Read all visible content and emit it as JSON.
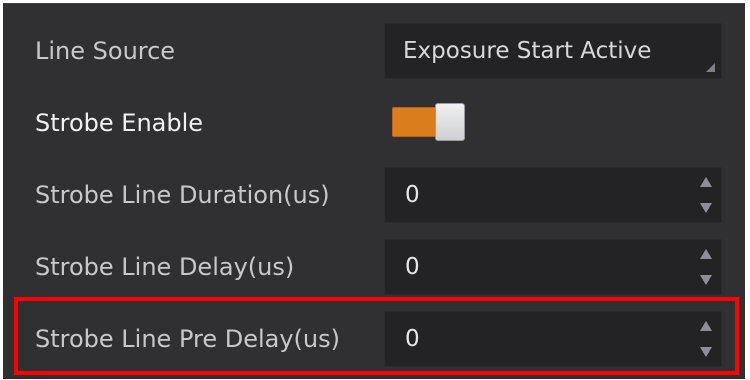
{
  "properties": [
    {
      "label": "Line Source",
      "type": "dropdown",
      "value": "Exposure Start Active"
    },
    {
      "label": "Strobe Enable",
      "type": "toggle",
      "enabled": true
    },
    {
      "label": "Strobe Line Duration(us)",
      "type": "spinbox",
      "value": "0"
    },
    {
      "label": "Strobe Line Delay(us)",
      "type": "spinbox",
      "value": "0"
    },
    {
      "label": "Strobe Line Pre Delay(us)",
      "type": "spinbox",
      "value": "0"
    }
  ],
  "colors": {
    "panel_background": "#303033",
    "field_background": "#232326",
    "label_text": "#c7c8cc",
    "toggle_on": "#d97d1d",
    "highlight_border": "#ff0000"
  },
  "icons": {
    "dropdown": "dropdown-corner-icon",
    "spinner_up": "spin-up-icon",
    "spinner_down": "spin-down-icon"
  }
}
